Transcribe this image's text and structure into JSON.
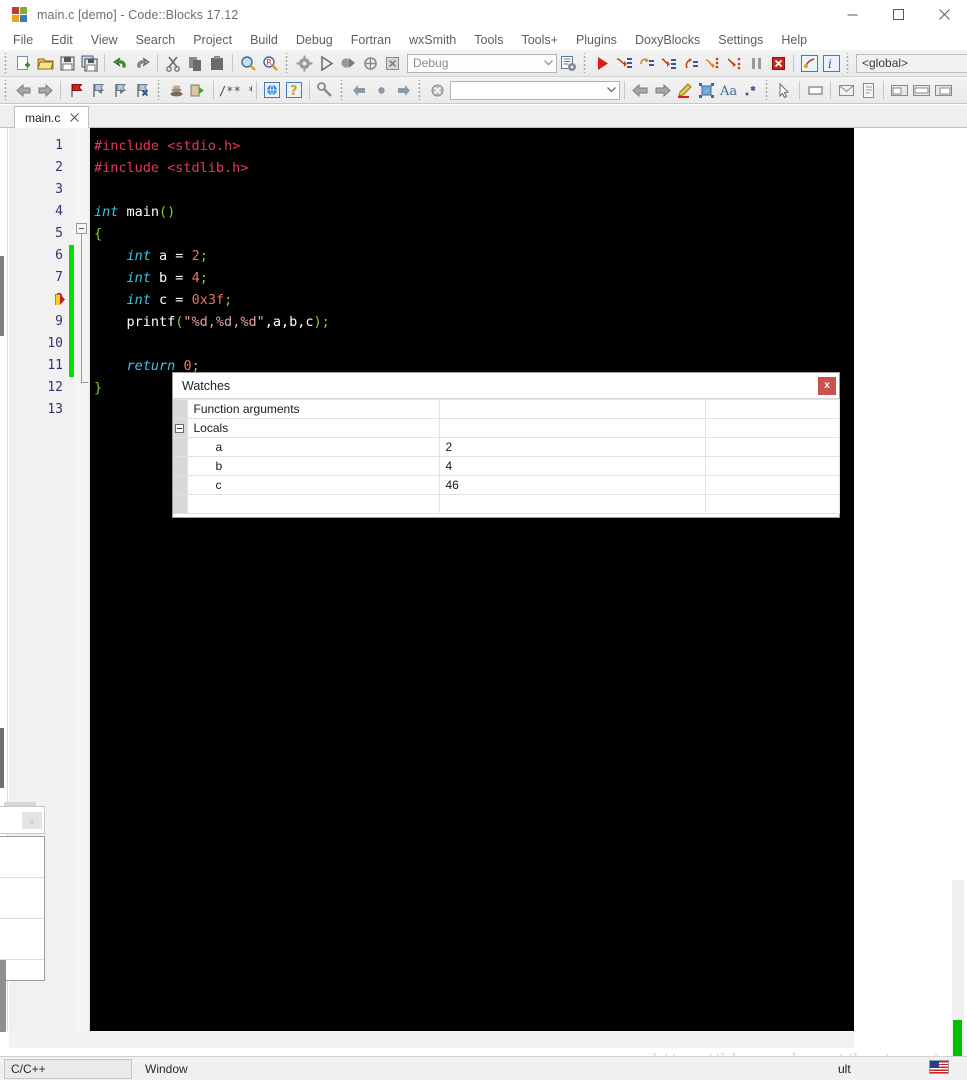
{
  "window": {
    "title": "main.c [demo] - Code::Blocks 17.12",
    "app_icon": "codeblocks-logo-icon",
    "minimize_label": "minimize-icon",
    "maximize_label": "maximize-icon",
    "close_label": "close-icon"
  },
  "menubar": {
    "items": [
      {
        "label": "File"
      },
      {
        "label": "Edit"
      },
      {
        "label": "View"
      },
      {
        "label": "Search"
      },
      {
        "label": "Project"
      },
      {
        "label": "Build"
      },
      {
        "label": "Debug"
      },
      {
        "label": "Fortran"
      },
      {
        "label": "wxSmith"
      },
      {
        "label": "Tools"
      },
      {
        "label": "Tools+"
      },
      {
        "label": "Plugins"
      },
      {
        "label": "DoxyBlocks"
      },
      {
        "label": "Settings"
      },
      {
        "label": "Help"
      }
    ]
  },
  "toolbar_main": {
    "build_target": {
      "value": "Debug",
      "placeholder": "Debug"
    },
    "debug_scope": {
      "value": "<global>",
      "placeholder": "<global>"
    },
    "icons": [
      "new-file-icon",
      "open-file-icon",
      "save-icon",
      "save-all-icon",
      "undo-icon",
      "redo-icon",
      "cut-icon",
      "copy-icon",
      "paste-icon",
      "find-icon",
      "replace-icon",
      "build-icon",
      "run-icon",
      "build-and-run-icon",
      "rebuild-icon",
      "abort-icon",
      "build-target-options-icon",
      "debug-continue-icon",
      "debug-run-to-cursor-icon",
      "debug-next-line-icon",
      "debug-step-into-icon",
      "debug-step-out-icon",
      "debug-next-instruction-icon",
      "debug-step-instruction-icon",
      "debug-break-icon",
      "debug-stop-icon",
      "debugging-windows-icon",
      "debug-info-icon"
    ]
  },
  "toolbar_secondary": {
    "search_field": {
      "value": "",
      "placeholder": ""
    },
    "icons": [
      "nav-back-icon",
      "nav-forward-icon",
      "bookmark-toggle-icon",
      "bookmark-prev-icon",
      "bookmark-next-icon",
      "bookmark-clear-icon",
      "doxyblocks-run-icon",
      "doxyblocks-extract-icon",
      "doxyblocks-comment-icon",
      "doxyblocks-browse-icon",
      "doxyblocks-help-icon",
      "doxyblocks-config-icon",
      "incremental-search-prev-icon",
      "incremental-search-point-icon",
      "incremental-search-next-icon",
      "incremental-search-clear-icon",
      "wxsmith-back-icon",
      "wxsmith-forward-icon",
      "wxsmith-edit-icon",
      "wxsmith-object-icon",
      "wxsmith-font-icon",
      "wxsmith-star-icon",
      "wxsmith-pointer-icon",
      "wxsmith-panel-icon",
      "wxsmith-dialog-icon",
      "wxsmith-frame-icon",
      "wxsmith-layout-a-icon",
      "wxsmith-layout-b-icon",
      "wxsmith-layout-c-icon"
    ]
  },
  "editor": {
    "tab": {
      "label": "main.c",
      "close_icon": "close-icon"
    },
    "current_debug_line": 8,
    "lines": [
      {
        "n": "1",
        "tokens": [
          {
            "t": "#include ",
            "c": "t-pre"
          },
          {
            "t": "<stdio.h>",
            "c": "t-inc"
          }
        ]
      },
      {
        "n": "2",
        "tokens": [
          {
            "t": "#include ",
            "c": "t-pre"
          },
          {
            "t": "<stdlib.h>",
            "c": "t-inc"
          }
        ]
      },
      {
        "n": "3",
        "tokens": []
      },
      {
        "n": "4",
        "tokens": [
          {
            "t": "int",
            "c": "t-kw"
          },
          {
            "t": " main",
            "c": "t-id"
          },
          {
            "t": "()",
            "c": "t-brc"
          }
        ]
      },
      {
        "n": "5",
        "tokens": [
          {
            "t": "{",
            "c": "t-brc"
          }
        ]
      },
      {
        "n": "6",
        "tokens": [
          {
            "t": "    ",
            "c": "t-op"
          },
          {
            "t": "int",
            "c": "t-kw"
          },
          {
            "t": " a ",
            "c": "t-id"
          },
          {
            "t": "= ",
            "c": "t-op"
          },
          {
            "t": "2",
            "c": "t-num"
          },
          {
            "t": ";",
            "c": "t-brc"
          }
        ]
      },
      {
        "n": "7",
        "tokens": [
          {
            "t": "    ",
            "c": "t-op"
          },
          {
            "t": "int",
            "c": "t-kw"
          },
          {
            "t": " b ",
            "c": "t-id"
          },
          {
            "t": "= ",
            "c": "t-op"
          },
          {
            "t": "4",
            "c": "t-num"
          },
          {
            "t": ";",
            "c": "t-brc"
          }
        ]
      },
      {
        "n": "8",
        "tokens": [
          {
            "t": "    ",
            "c": "t-op"
          },
          {
            "t": "int",
            "c": "t-kw"
          },
          {
            "t": " c ",
            "c": "t-id"
          },
          {
            "t": "= ",
            "c": "t-op"
          },
          {
            "t": "0x3f",
            "c": "t-num"
          },
          {
            "t": ";",
            "c": "t-brc"
          }
        ]
      },
      {
        "n": "9",
        "tokens": [
          {
            "t": "    printf",
            "c": "t-fn"
          },
          {
            "t": "(",
            "c": "t-brc"
          },
          {
            "t": "\"%d,%d,%d\"",
            "c": "t-str"
          },
          {
            "t": ",a,b,c",
            "c": "t-id"
          },
          {
            "t": ");",
            "c": "t-brc"
          }
        ]
      },
      {
        "n": "10",
        "tokens": []
      },
      {
        "n": "11",
        "tokens": [
          {
            "t": "    ",
            "c": "t-op"
          },
          {
            "t": "return",
            "c": "t-kw"
          },
          {
            "t": " ",
            "c": "t-id"
          },
          {
            "t": "0",
            "c": "t-num"
          },
          {
            "t": ";",
            "c": "t-brc"
          }
        ]
      },
      {
        "n": "12",
        "tokens": [
          {
            "t": "}",
            "c": "t-brc"
          }
        ]
      },
      {
        "n": "13",
        "tokens": []
      }
    ],
    "change_bar_lines": [
      6,
      7,
      8,
      9,
      10,
      11
    ],
    "scroll_left_icon": "scroll-left-arrow-icon",
    "scroll_right_icon": "scroll-right-arrow-icon"
  },
  "watches": {
    "title": "Watches",
    "close_icon": "close-icon",
    "rows": [
      {
        "expander": "",
        "name": "Function arguments",
        "value": "",
        "type": "",
        "is_var": false
      },
      {
        "expander": "collapse",
        "name": "Locals",
        "value": "",
        "type": "",
        "is_var": false
      },
      {
        "expander": "",
        "name": "a",
        "value": "2",
        "type": "",
        "is_var": true
      },
      {
        "expander": "",
        "name": "b",
        "value": "4",
        "type": "",
        "is_var": true
      },
      {
        "expander": "",
        "name": "c",
        "value": "46",
        "type": "",
        "is_var": true
      },
      {
        "expander": "",
        "name": "",
        "value": "",
        "type": "",
        "is_var": false
      }
    ]
  },
  "float_panel": {
    "close_icon": "close-icon"
  },
  "statusbar": {
    "language": "C/C++",
    "platform": "Window",
    "profile": "ult",
    "keyboard_icon": "us-flag-icon"
  },
  "watermark": {
    "text": "https://blog.csdn.net/bestsport"
  },
  "colors": {
    "accent_green": "#00c000",
    "watch_value_red": "#d41717",
    "close_button_red": "#c9524f",
    "editor_background": "#000000",
    "keyword_cyan": "#3bc6ea",
    "preprocessor_pink": "#e8355b",
    "brace_green": "#7fd42a"
  }
}
